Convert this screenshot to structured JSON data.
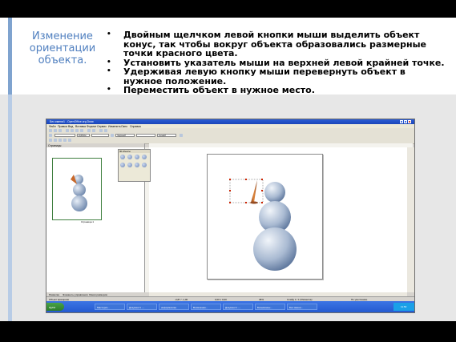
{
  "slide": {
    "title": "Изменение ориентации объекта.",
    "bullets": [
      "Двойным щелчком левой кнопки мыши выделить объект конус, так чтобы вокруг объекта образовались размерные точки красного цвета.",
      "Установить указатель мыши на  верхней левой крайней точке.",
      "Удерживая левую кнопку мыши перевернуть объект в нужное положение.",
      "Переместить объект в нужное место."
    ],
    "colors": {
      "title": "#4f7fbf",
      "accent_stripe": "#7fa3cf",
      "background_band": "#e7e7e7",
      "selection_handles": "#cc2200"
    }
  },
  "app": {
    "window_title": "Без имени1 - OpenOffice.org Draw",
    "menu": [
      "Файл",
      "Правка",
      "Вид",
      "Вставка",
      "Формат",
      "Сервис",
      "Изменить",
      "Окно",
      "Справка"
    ],
    "toolbar_combos": [
      "",
      "0,00см",
      "",
      "Черный",
      "",
      "Синий"
    ],
    "pages_panel_title": "Страницы",
    "thumbnail_label": "Страница 1",
    "float_panel_title": "3D-объекты",
    "tabs": [
      "Разметка",
      "Элементы управления",
      "Линии размеров"
    ],
    "status": {
      "selection": "Объект вращения",
      "position": "-3,87 / -1,00",
      "size": "0,00 x 0,00",
      "zoom": "45%",
      "page": "Слайд 1 / 1 (Разметка)",
      "style": "По умолчанию"
    },
    "taskbar": {
      "start": "пуск",
      "tasks": [
        "Мастерск...",
        "Документ1 -...",
        "информатика",
        "Возможная...",
        "Документ1 -...",
        "Безымянны...",
        "Без имени..."
      ],
      "clock": "11:50"
    }
  }
}
